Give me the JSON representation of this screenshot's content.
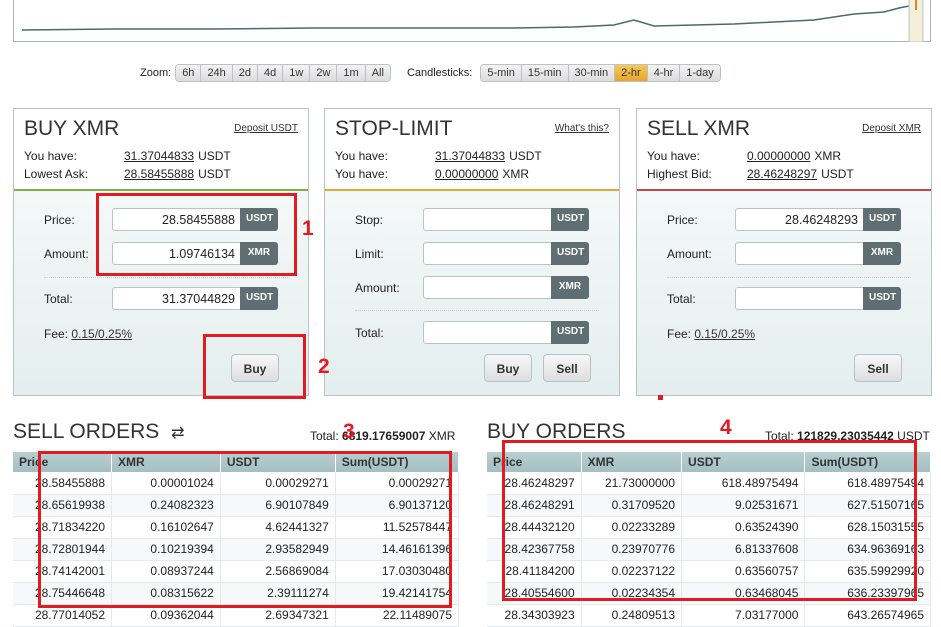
{
  "zoom": {
    "label": "Zoom:",
    "options": [
      "6h",
      "24h",
      "2d",
      "4d",
      "1w",
      "2w",
      "1m",
      "All"
    ]
  },
  "candlesticks": {
    "label": "Candlesticks:",
    "options": [
      "5-min",
      "15-min",
      "30-min",
      "2-hr",
      "4-hr",
      "1-day"
    ],
    "selected": "2-hr"
  },
  "buy": {
    "title": "BUY XMR",
    "link": "Deposit USDT",
    "have_label": "You have:",
    "have_value": "31.37044833",
    "have_unit": "USDT",
    "ask_label": "Lowest Ask:",
    "ask_value": "28.58455888",
    "ask_unit": "USDT",
    "price_label": "Price:",
    "price_value": "28.58455888",
    "price_unit": "USDT",
    "amount_label": "Amount:",
    "amount_value": "1.09746134",
    "amount_unit": "XMR",
    "total_label": "Total:",
    "total_value": "31.37044829",
    "total_unit": "USDT",
    "fee_label": "Fee:",
    "fee_value": "0.15/0.25%",
    "button": "Buy"
  },
  "stop_limit": {
    "title": "STOP-LIMIT",
    "link": "What's this?",
    "have_label": "You have:",
    "have_usdt": "31.37044833",
    "have_usdt_unit": "USDT",
    "have_label2": "You have:",
    "have_xmr": "0.00000000",
    "have_xmr_unit": "XMR",
    "stop_label": "Stop:",
    "stop_unit": "USDT",
    "limit_label": "Limit:",
    "limit_unit": "USDT",
    "amount_label": "Amount:",
    "amount_unit": "XMR",
    "total_label": "Total:",
    "total_unit": "USDT",
    "buy_button": "Buy",
    "sell_button": "Sell"
  },
  "sell": {
    "title": "SELL XMR",
    "link": "Deposit XMR",
    "have_label": "You have:",
    "have_value": "0.00000000",
    "have_unit": "XMR",
    "bid_label": "Highest Bid:",
    "bid_value": "28.46248297",
    "bid_unit": "USDT",
    "price_label": "Price:",
    "price_value": "28.46248293",
    "price_unit": "USDT",
    "amount_label": "Amount:",
    "amount_unit": "XMR",
    "total_label": "Total:",
    "total_unit": "USDT",
    "fee_label": "Fee:",
    "fee_value": "0.15/0.25%",
    "button": "Sell"
  },
  "sell_orders": {
    "title": "SELL ORDERS",
    "total_label": "Total:",
    "total_value": "6819.17659007",
    "total_unit": "XMR",
    "headers": [
      "Price",
      "XMR",
      "USDT",
      "Sum(USDT)"
    ],
    "rows": [
      [
        "28.58455888",
        "0.00001024",
        "0.00029271",
        "0.00029271"
      ],
      [
        "28.65619938",
        "0.24082323",
        "6.90107849",
        "6.90137120"
      ],
      [
        "28.71834220",
        "0.16102647",
        "4.62441327",
        "11.52578447"
      ],
      [
        "28.72801944",
        "0.10219394",
        "2.93582949",
        "14.46161396"
      ],
      [
        "28.74142001",
        "0.08937244",
        "2.56869084",
        "17.03030480"
      ],
      [
        "28.75446648",
        "0.08315622",
        "2.39111274",
        "19.42141754"
      ],
      [
        "28.77014052",
        "0.09362044",
        "2.69347321",
        "22.11489075"
      ]
    ]
  },
  "buy_orders": {
    "title": "BUY ORDERS",
    "total_label": "Total:",
    "total_value": "121829.23035442",
    "total_unit": "USDT",
    "headers": [
      "Price",
      "XMR",
      "USDT",
      "Sum(USDT)"
    ],
    "rows": [
      [
        "28.46248297",
        "21.73000000",
        "618.48975494",
        "618.48975494"
      ],
      [
        "28.46248291",
        "0.31709520",
        "9.02531671",
        "627.51507165"
      ],
      [
        "28.44432120",
        "0.02233289",
        "0.63524390",
        "628.15031555"
      ],
      [
        "28.42367758",
        "0.23970776",
        "6.81337608",
        "634.96369163"
      ],
      [
        "28.41184200",
        "0.02237122",
        "0.63560757",
        "635.59929920"
      ],
      [
        "28.40554600",
        "0.02234354",
        "0.63468045",
        "636.23397965"
      ],
      [
        "28.34303923",
        "0.24809513",
        "7.03177000",
        "643.26574965"
      ]
    ]
  },
  "annotations": [
    "1",
    "2",
    "3",
    "4"
  ],
  "colors": {
    "accent_orange": "#e7a529",
    "buy_green": "#7fb14a",
    "sell_red": "#c54545",
    "annotation_red": "#e01b22",
    "header_teal": "#a3bfc2"
  }
}
